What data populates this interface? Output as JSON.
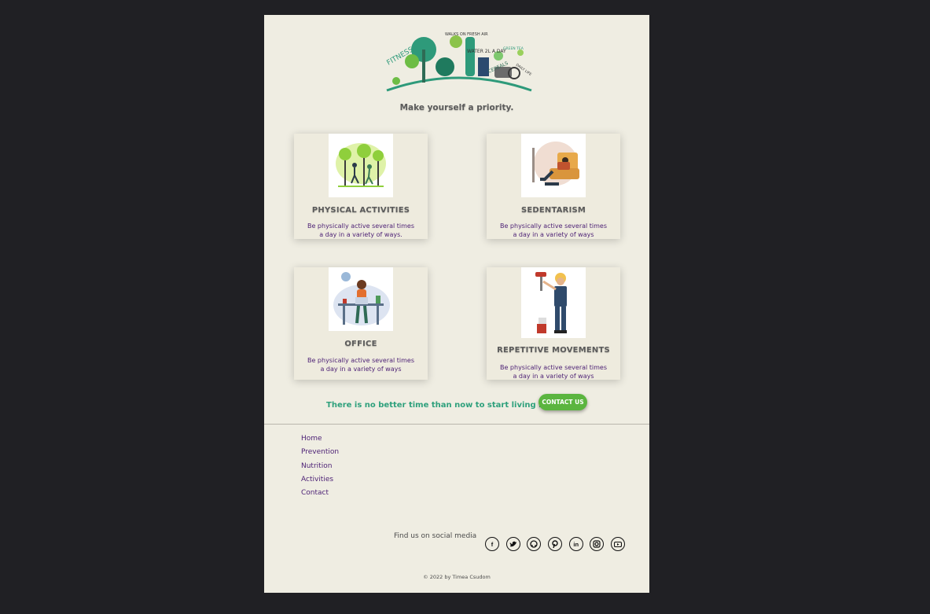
{
  "tagline": "Make yourself a priority.",
  "hero_words": [
    "FITNESS",
    "WALKS ON FRESH AIR",
    "WATER 2L A DAY",
    "GREEN TEA",
    "CEREALS",
    "DAILY LIFE"
  ],
  "cards": [
    {
      "title": "PHYSICAL ACTIVITIES",
      "desc": "Be physically active several times a day in a variety of ways.",
      "image": "running-people-illustration"
    },
    {
      "title": "SEDENTARISM",
      "desc": "Be physically active several times a day in a variety of ways",
      "image": "person-on-couch-illustration"
    },
    {
      "title": "OFFICE",
      "desc": "Be physically active several times a day in a variety of ways",
      "image": "office-desk-illustration"
    },
    {
      "title": "REPETITIVE MOVEMENTS",
      "desc": "Be physically active several times a day in a variety of ways",
      "image": "painter-worker-illustration"
    }
  ],
  "cta": {
    "text": "There is no better time than now to start living healthy.",
    "button": "CONTACT US"
  },
  "footer": {
    "nav": [
      "Home",
      "Prevention",
      "Nutrition",
      "Activities",
      "Contact"
    ],
    "social_label": "Find us on social media",
    "social_icons": [
      "facebook-icon",
      "twitter-icon",
      "github-icon",
      "pinterest-icon",
      "linkedin-icon",
      "instagram-icon",
      "youtube-icon"
    ],
    "copyright": "© 2022 by Timea Csudom"
  },
  "colors": {
    "page_bg": "#efede2",
    "outer_bg": "#202024",
    "accent_green": "#5bb53f",
    "cta_text": "#2ea07c",
    "link_purple": "#4b1f74"
  }
}
